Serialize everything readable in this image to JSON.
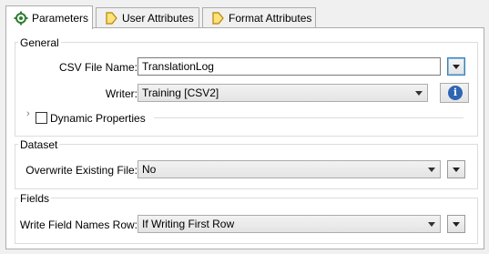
{
  "tabs": [
    {
      "label": "Parameters",
      "icon": "gear-icon",
      "active": true
    },
    {
      "label": "User Attributes",
      "icon": "arrow-tag-icon",
      "active": false
    },
    {
      "label": "Format Attributes",
      "icon": "arrow-tag-icon",
      "active": false
    }
  ],
  "general": {
    "title": "General",
    "csv_file_name_label": "CSV File Name:",
    "csv_file_name_value": "TranslationLog",
    "writer_label": "Writer:",
    "writer_value": "Training [CSV2]",
    "dynamic_properties_label": "Dynamic Properties",
    "dynamic_properties_checked": false
  },
  "dataset": {
    "title": "Dataset",
    "overwrite_label": "Overwrite Existing File:",
    "overwrite_value": "No"
  },
  "fields": {
    "title": "Fields",
    "write_field_names_label": "Write Field Names Row:",
    "write_field_names_value": "If Writing First Row"
  },
  "colors": {
    "info_icon": "#2f66b3",
    "focus_border": "#3c7fb1",
    "tab_icon": "#d8a300"
  }
}
